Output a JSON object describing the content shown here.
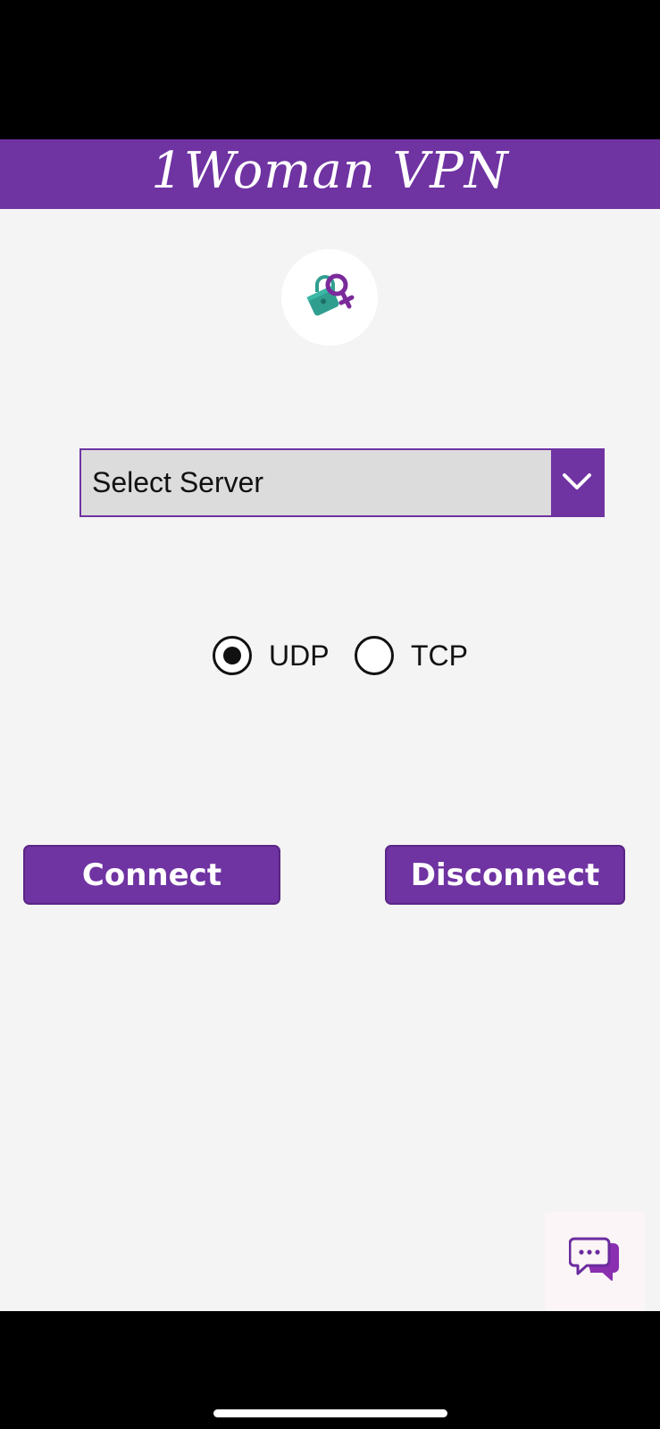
{
  "header": {
    "title": "1Woman VPN"
  },
  "logo": {
    "icon": "lock-female-symbol-icon"
  },
  "server_select": {
    "selected": "Select Server",
    "icon": "chevron-down-icon"
  },
  "protocol": {
    "options": [
      {
        "label": "UDP",
        "selected": true
      },
      {
        "label": "TCP",
        "selected": false
      }
    ]
  },
  "buttons": {
    "connect_label": "Connect",
    "disconnect_label": "Disconnect"
  },
  "chat": {
    "icon": "chat-bubbles-icon"
  },
  "colors": {
    "brand": "#6f33a2",
    "background": "#f4f4f4",
    "lock": "#2f9e8f"
  }
}
